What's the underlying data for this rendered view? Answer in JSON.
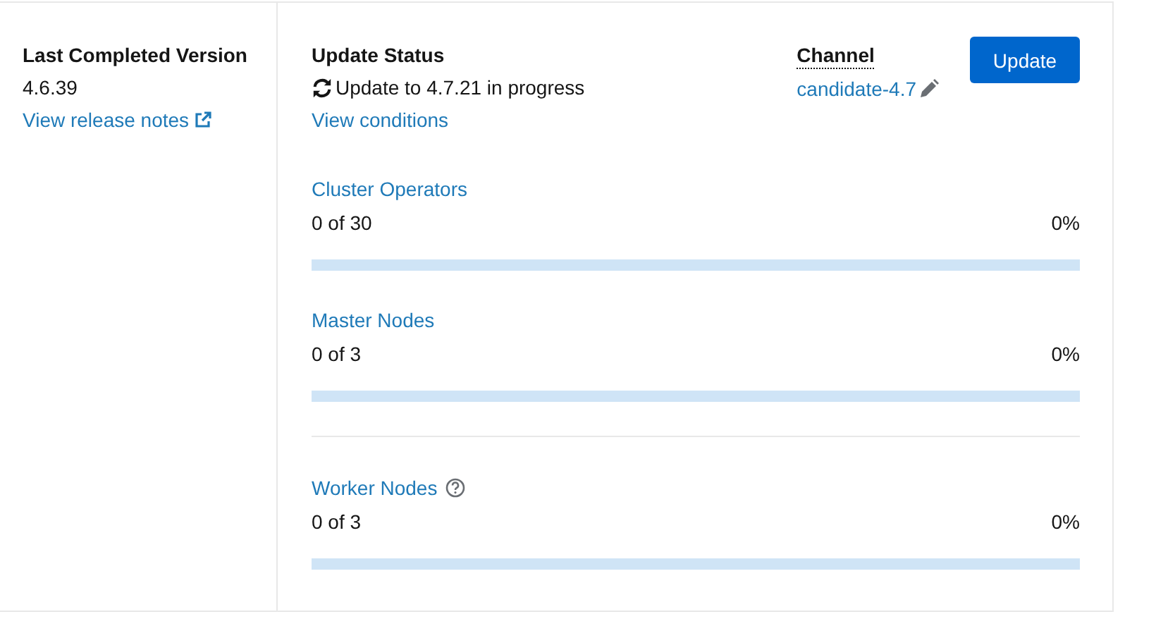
{
  "last_completed": {
    "label": "Last Completed Version",
    "version": "4.6.39",
    "link": "View release notes"
  },
  "update_status": {
    "label": "Update Status",
    "status": "Update to 4.7.21 in progress",
    "in_progress": true,
    "link": "View conditions"
  },
  "channel": {
    "label": "Channel",
    "value": "candidate-4.7"
  },
  "update_button": "Update",
  "progress_groups": [
    {
      "title": "Cluster Operators",
      "count": "0 of 30",
      "percent": "0%",
      "level": 0,
      "help": false,
      "divider_before": false
    },
    {
      "title": "Master Nodes",
      "count": "0 of 3",
      "percent": "0%",
      "level": 0,
      "help": false,
      "divider_before": false
    },
    {
      "title": "Worker Nodes",
      "count": "0 of 3",
      "percent": "0%",
      "level": 0,
      "help": true,
      "divider_before": true
    }
  ]
}
